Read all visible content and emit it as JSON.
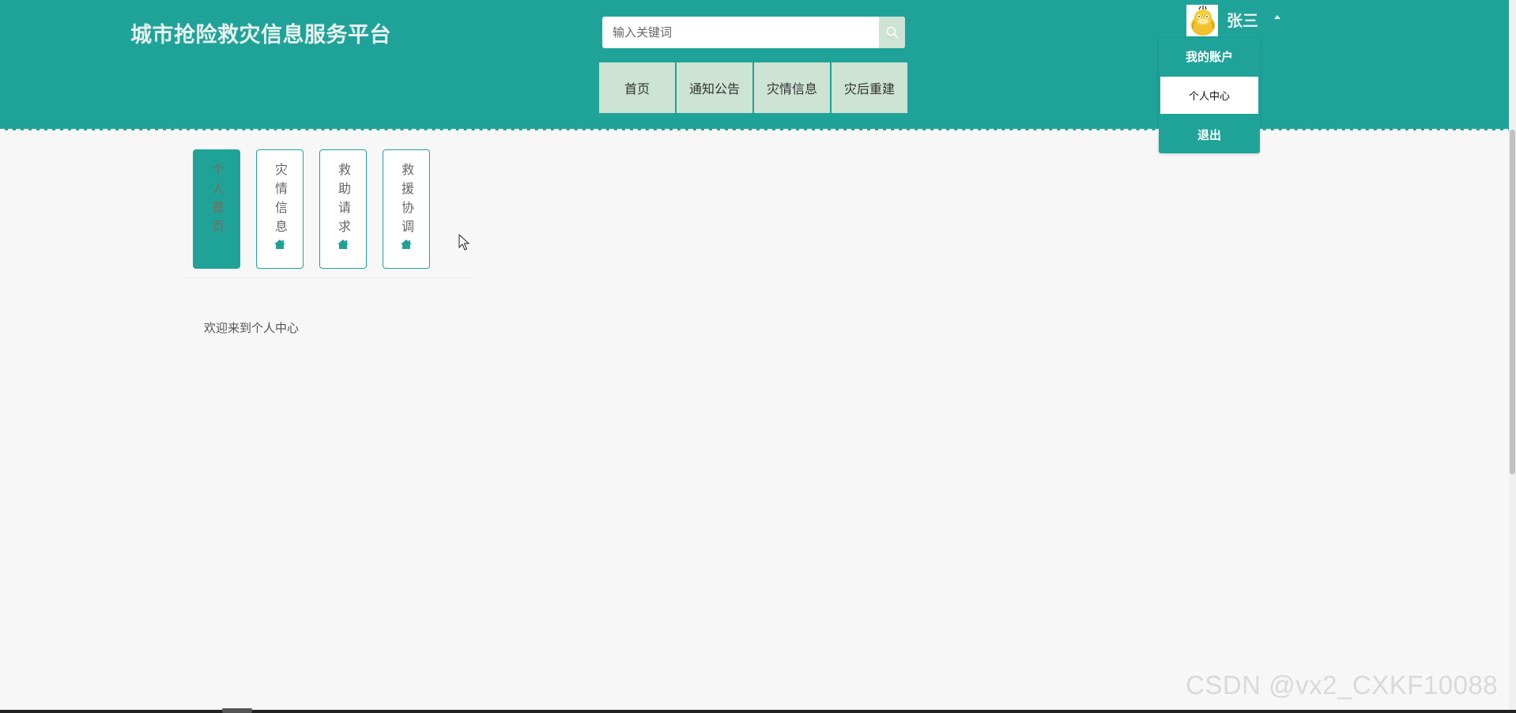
{
  "header": {
    "site_title": "城市抢险救灾信息服务平台",
    "search": {
      "placeholder": "输入关键词",
      "value": ""
    },
    "nav": [
      {
        "label": "首页"
      },
      {
        "label": "通知公告"
      },
      {
        "label": "灾情信息"
      },
      {
        "label": "灾后重建"
      }
    ]
  },
  "user": {
    "name": "张三",
    "menu": {
      "title": "我的账户",
      "items": [
        {
          "label": "个人中心",
          "active": true
        },
        {
          "label": "退出",
          "active": false
        }
      ]
    }
  },
  "side_tabs": [
    {
      "label": "个人首页",
      "active": true,
      "icon": "home-icon"
    },
    {
      "label": "灾情信息",
      "active": false,
      "icon": "home-icon"
    },
    {
      "label": "救助请求",
      "active": false,
      "icon": "home-icon"
    },
    {
      "label": "救援协调",
      "active": false,
      "icon": "home-icon"
    }
  ],
  "content": {
    "welcome_text": "欢迎来到个人中心"
  },
  "watermark": "CSDN @vx2_CXKF10088",
  "colors": {
    "primary": "#1fa399",
    "nav_bg": "#cde3d3",
    "page_bg": "#f7f7f7"
  }
}
